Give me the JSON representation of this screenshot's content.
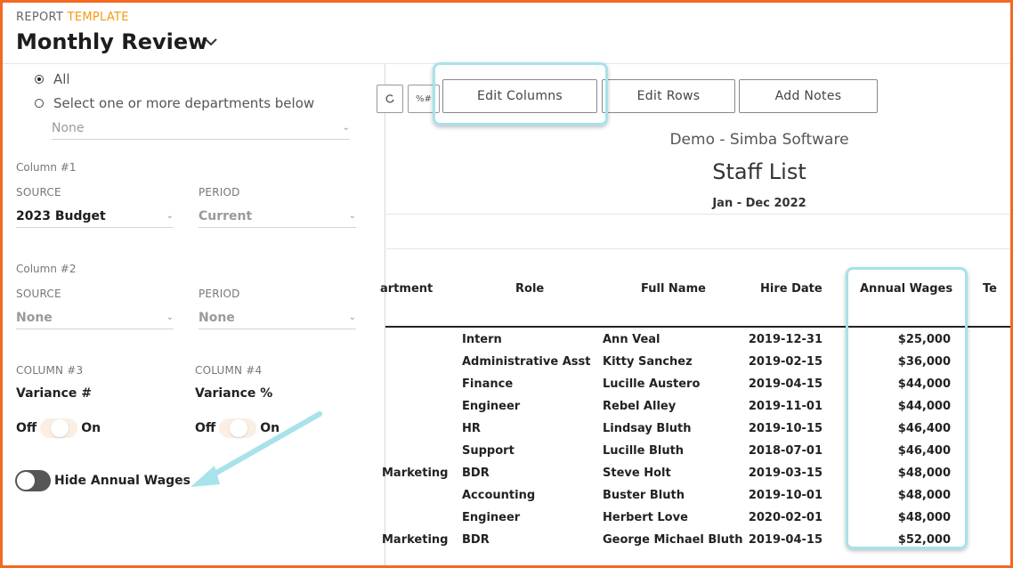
{
  "header": {
    "report_label": "REPORT",
    "template_label": "TEMPLATE",
    "title": "Monthly Review"
  },
  "filters": {
    "all_label": "All",
    "select_label": "Select one or more departments below",
    "departments_value": "None"
  },
  "column1": {
    "heading": "Column #1",
    "source_label": "SOURCE",
    "source_value": "2023 Budget",
    "period_label": "PERIOD",
    "period_value": "Current"
  },
  "column2": {
    "heading": "Column #2",
    "source_label": "SOURCE",
    "source_value": "None",
    "period_label": "PERIOD",
    "period_value": "None"
  },
  "column3": {
    "heading": "COLUMN #3",
    "title": "Variance #",
    "off": "Off",
    "on": "On"
  },
  "column4": {
    "heading": "COLUMN #4",
    "title": "Variance %",
    "off": "Off",
    "on": "On"
  },
  "hide_wages_label": "Hide Annual Wages",
  "toolbar": {
    "icon2_text": "%#",
    "edit_columns": "Edit Columns",
    "edit_rows": "Edit Rows",
    "add_notes": "Add Notes"
  },
  "report": {
    "company": "Demo - Simba Software",
    "title": "Staff List",
    "date_range": "Jan - Dec 2022"
  },
  "table": {
    "headers": [
      "artment",
      "Role",
      "Full Name",
      "Hire Date",
      "Annual Wages",
      "Te"
    ],
    "rows": [
      {
        "dept": "",
        "role": "Intern",
        "name": "Ann Veal",
        "hire": "2019-12-31",
        "wages": "$25,000"
      },
      {
        "dept": "",
        "role": "Administrative Asst",
        "name": "Kitty Sanchez",
        "hire": "2019-02-15",
        "wages": "$36,000"
      },
      {
        "dept": "",
        "role": "Finance",
        "name": "Lucille Austero",
        "hire": "2019-04-15",
        "wages": "$44,000"
      },
      {
        "dept": "",
        "role": "Engineer",
        "name": "Rebel Alley",
        "hire": "2019-11-01",
        "wages": "$44,000"
      },
      {
        "dept": "",
        "role": "HR",
        "name": "Lindsay Bluth",
        "hire": "2019-10-15",
        "wages": "$46,400"
      },
      {
        "dept": "",
        "role": "Support",
        "name": "Lucille Bluth",
        "hire": "2018-07-01",
        "wages": "$46,400"
      },
      {
        "dept": "Marketing",
        "role": "BDR",
        "name": "Steve Holt",
        "hire": "2019-03-15",
        "wages": "$48,000"
      },
      {
        "dept": "",
        "role": "Accounting",
        "name": "Buster Bluth",
        "hire": "2019-10-01",
        "wages": "$48,000"
      },
      {
        "dept": "",
        "role": "Engineer",
        "name": "Herbert Love",
        "hire": "2020-02-01",
        "wages": "$48,000"
      },
      {
        "dept": "Marketing",
        "role": "BDR",
        "name": "George Michael Bluth",
        "hire": "2019-04-15",
        "wages": "$52,000"
      }
    ]
  },
  "colors": {
    "frame": "#f26a22",
    "template_accent": "#f59a10",
    "highlight": "#a8e2ea"
  }
}
